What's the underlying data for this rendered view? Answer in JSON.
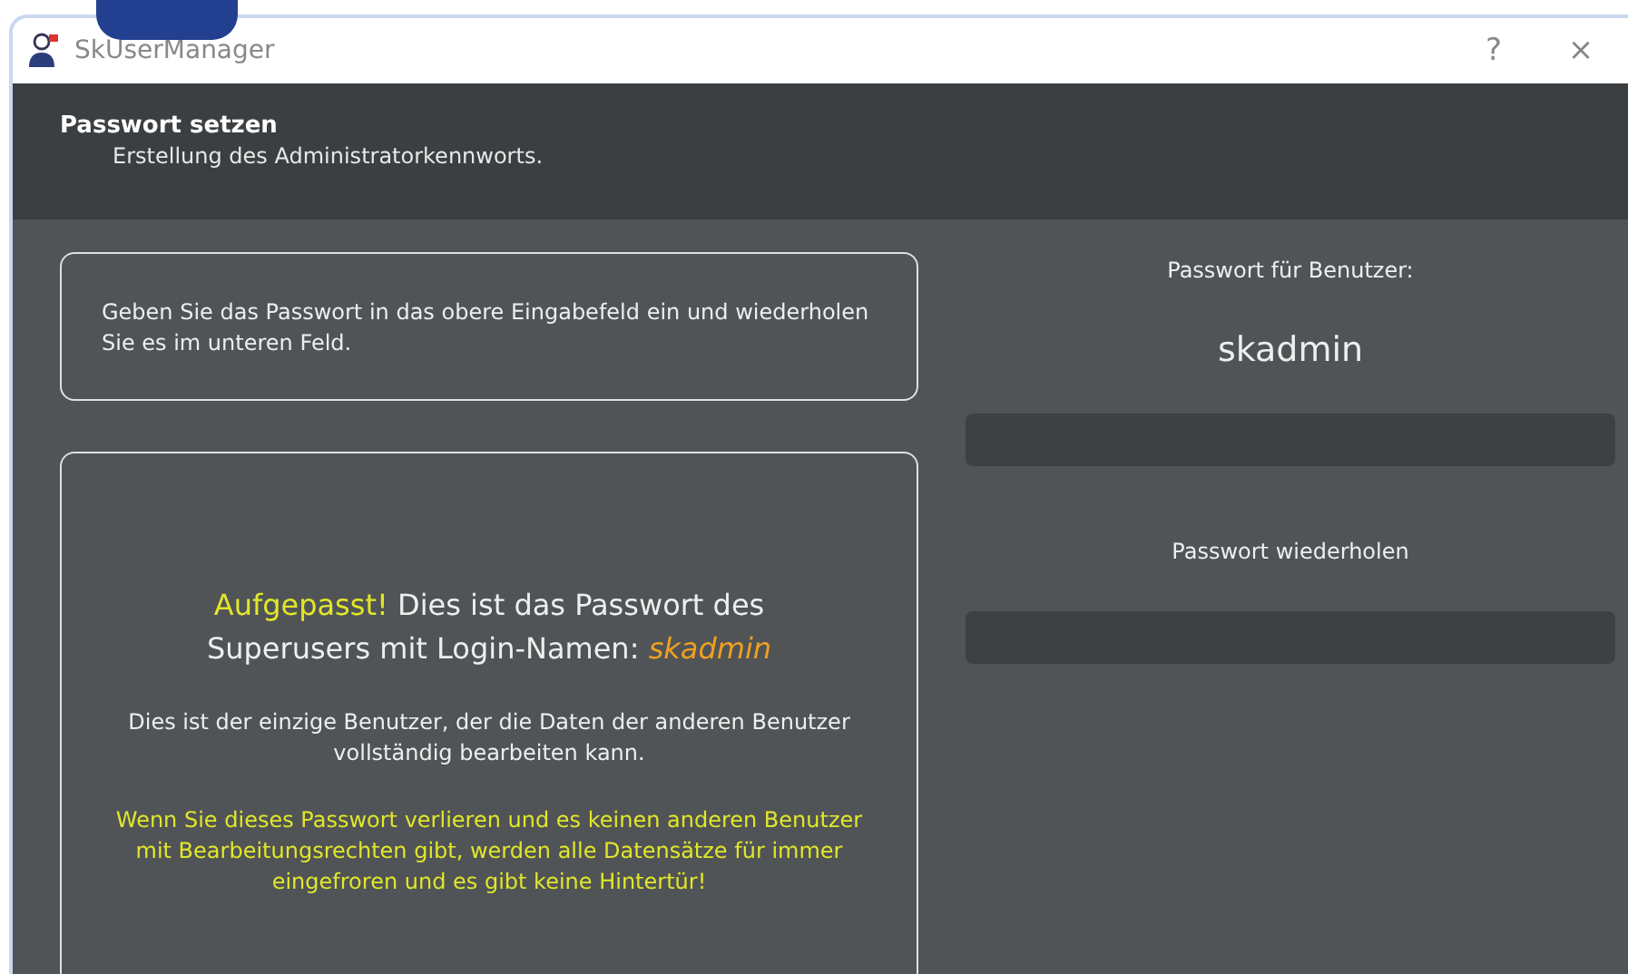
{
  "window": {
    "title": "SkUserManager",
    "help": "?",
    "close": "×"
  },
  "header": {
    "title": "Passwort setzen",
    "subtitle": "Erstellung des Administratorkennworts."
  },
  "instructions": "Geben Sie das Passwort in das obere Eingabefeld ein und wiederholen Sie es im unteren Feld.",
  "warning": {
    "lead": "Aufgepasst!",
    "text": "Dies ist das Passwort des Superusers mit Login-Namen:",
    "login": "skadmin",
    "info": "Dies ist der einzige Benutzer, der die Daten der anderen Benutzer vollständig bearbeiten kann.",
    "alert": "Wenn Sie dieses Passwort verlieren und es keinen anderen Benutzer mit Bearbeitungsrechten gibt, werden alle Datensätze für immer eingefroren und es gibt keine Hintertür!"
  },
  "form": {
    "user_label": "Passwort für Benutzer:",
    "user": "skadmin",
    "fields": [
      {
        "kind": "password"
      },
      {
        "kind": "repeat",
        "label": "Passwort wiederholen"
      }
    ]
  }
}
